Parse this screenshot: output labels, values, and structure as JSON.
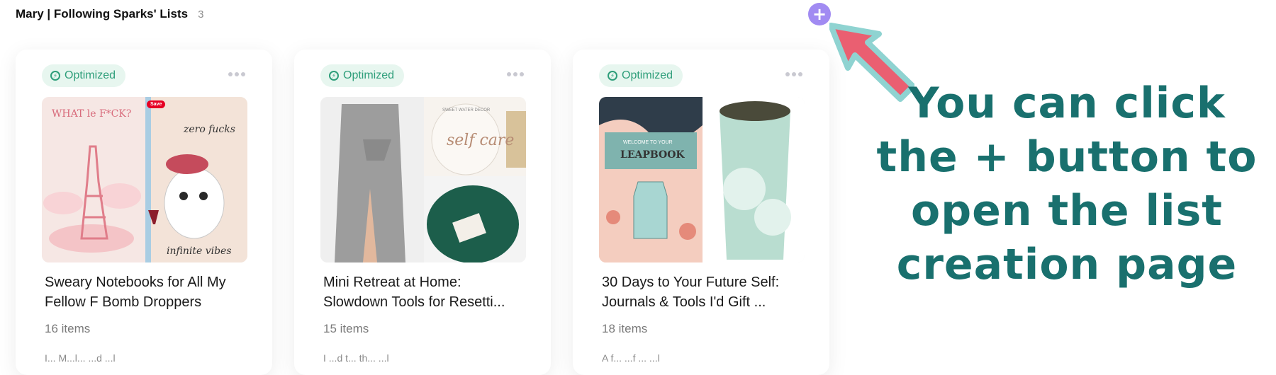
{
  "header": {
    "title": "Mary | Following Sparks' Lists",
    "count": "3"
  },
  "add_button": {
    "label": "+"
  },
  "cards": [
    {
      "badge": "Optimized",
      "title": "Sweary Notebooks for All My Fellow F Bomb Droppers",
      "count": "16 items",
      "desc": "I... M...l... ...d ...l",
      "thumb_texts": {
        "left": "WHAT le F*CK?",
        "right_top": "zero fucks",
        "right_bottom": "infinite vibes",
        "save": "Save"
      }
    },
    {
      "badge": "Optimized",
      "title": "Mini Retreat at Home: Slowdown Tools for Resetti...",
      "count": "15 items",
      "desc": "I ...d t... th... ...l",
      "thumb_texts": {
        "jar_top": "SWEET WATER DECOR",
        "jar_main": "self care"
      }
    },
    {
      "badge": "Optimized",
      "title": "30 Days to Your Future Self: Journals & Tools I'd Gift ...",
      "count": "18 items",
      "desc": "A f... ...f ... ...l",
      "thumb_texts": {
        "book_top": "WELCOME TO YOUR",
        "book_title": "LEAPBOOK"
      }
    }
  ],
  "callout": {
    "lines": [
      "You can click",
      "the + button to",
      "open the list",
      "creation page"
    ]
  },
  "colors": {
    "accent": "#a18bf2",
    "optimized_badge_bg": "#e7f6ef",
    "optimized_badge_text": "#2e9e7a",
    "callout_text": "#19706e",
    "arrow_fill": "#ea5f71",
    "arrow_outline": "#8fd3d1"
  },
  "icons": {
    "optimized": "bolt-circle-icon",
    "more": "more-horizontal-icon",
    "add": "plus-icon",
    "arrow": "pointer-arrow-icon"
  }
}
